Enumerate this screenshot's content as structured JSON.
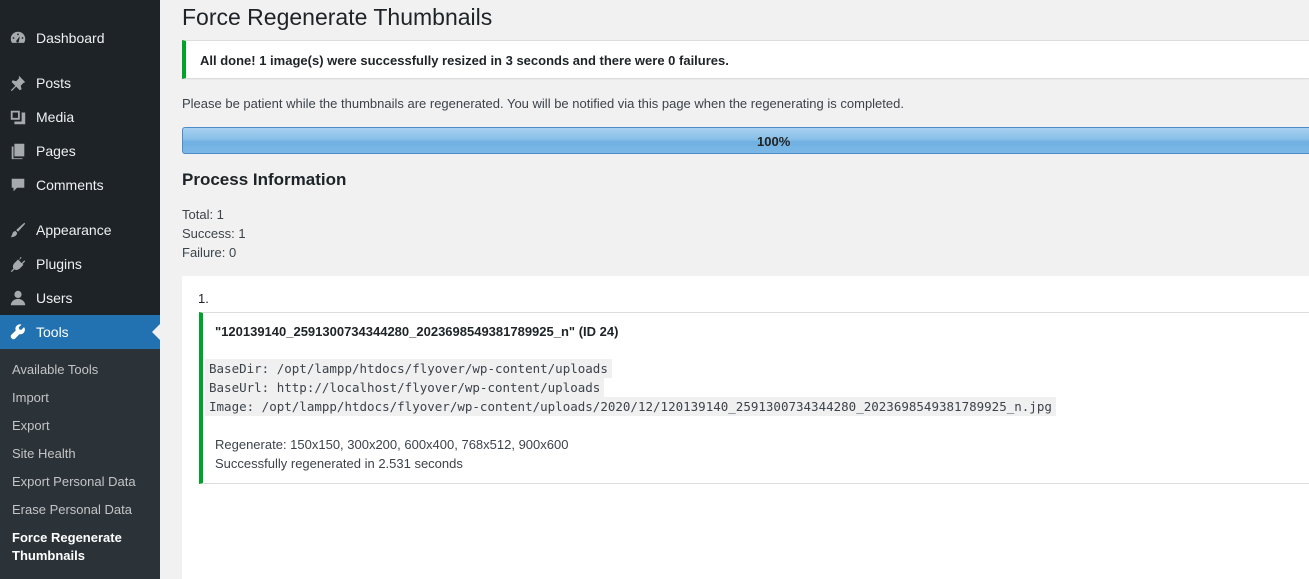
{
  "sidebar": {
    "items": [
      {
        "label": "Dashboard",
        "icon": "dashboard-icon"
      },
      {
        "label": "Posts",
        "icon": "pin-icon"
      },
      {
        "label": "Media",
        "icon": "media-icon"
      },
      {
        "label": "Pages",
        "icon": "pages-icon"
      },
      {
        "label": "Comments",
        "icon": "comment-icon"
      },
      {
        "label": "Appearance",
        "icon": "paintbrush-icon"
      },
      {
        "label": "Plugins",
        "icon": "plugin-icon"
      },
      {
        "label": "Users",
        "icon": "user-icon"
      },
      {
        "label": "Tools",
        "icon": "wrench-icon"
      }
    ],
    "submenu": [
      "Available Tools",
      "Import",
      "Export",
      "Site Health",
      "Export Personal Data",
      "Erase Personal Data",
      "Force Regenerate",
      "Thumbnails"
    ]
  },
  "page": {
    "title": "Force Regenerate Thumbnails",
    "notice": "All done! 1 image(s) were successfully resized in 3 seconds and there were 0 failures.",
    "description": "Please be patient while the thumbnails are regenerated. You will be notified via this page when the regenerating is completed.",
    "progress_label": "100%",
    "progress_value": 1.0,
    "section_title": "Process Information",
    "total": "Total: 1",
    "success": "Success: 1",
    "failure": "Failure: 0"
  },
  "results": {
    "number": "1.",
    "filename": "\"120139140_2591300734344280_2023698549381789925_n\" (ID 24)",
    "basedir": "BaseDir: /opt/lampp/htdocs/flyover/wp-content/uploads",
    "baseurl": "BaseUrl: http://localhost/flyover/wp-content/uploads",
    "image": "Image: /opt/lampp/htdocs/flyover/wp-content/uploads/2020/12/120139140_2591300734344280_2023698549381789925_n.jpg",
    "regenerate": "Regenerate: 150x150, 300x200, 600x400, 768x512, 900x600",
    "status": "Successfully regenerated in 2.531 seconds"
  },
  "colors": {
    "sidebar_bg": "#1d2327",
    "submenu_bg": "#2c3338",
    "active": "#2271b1",
    "success": "#00a32a"
  }
}
